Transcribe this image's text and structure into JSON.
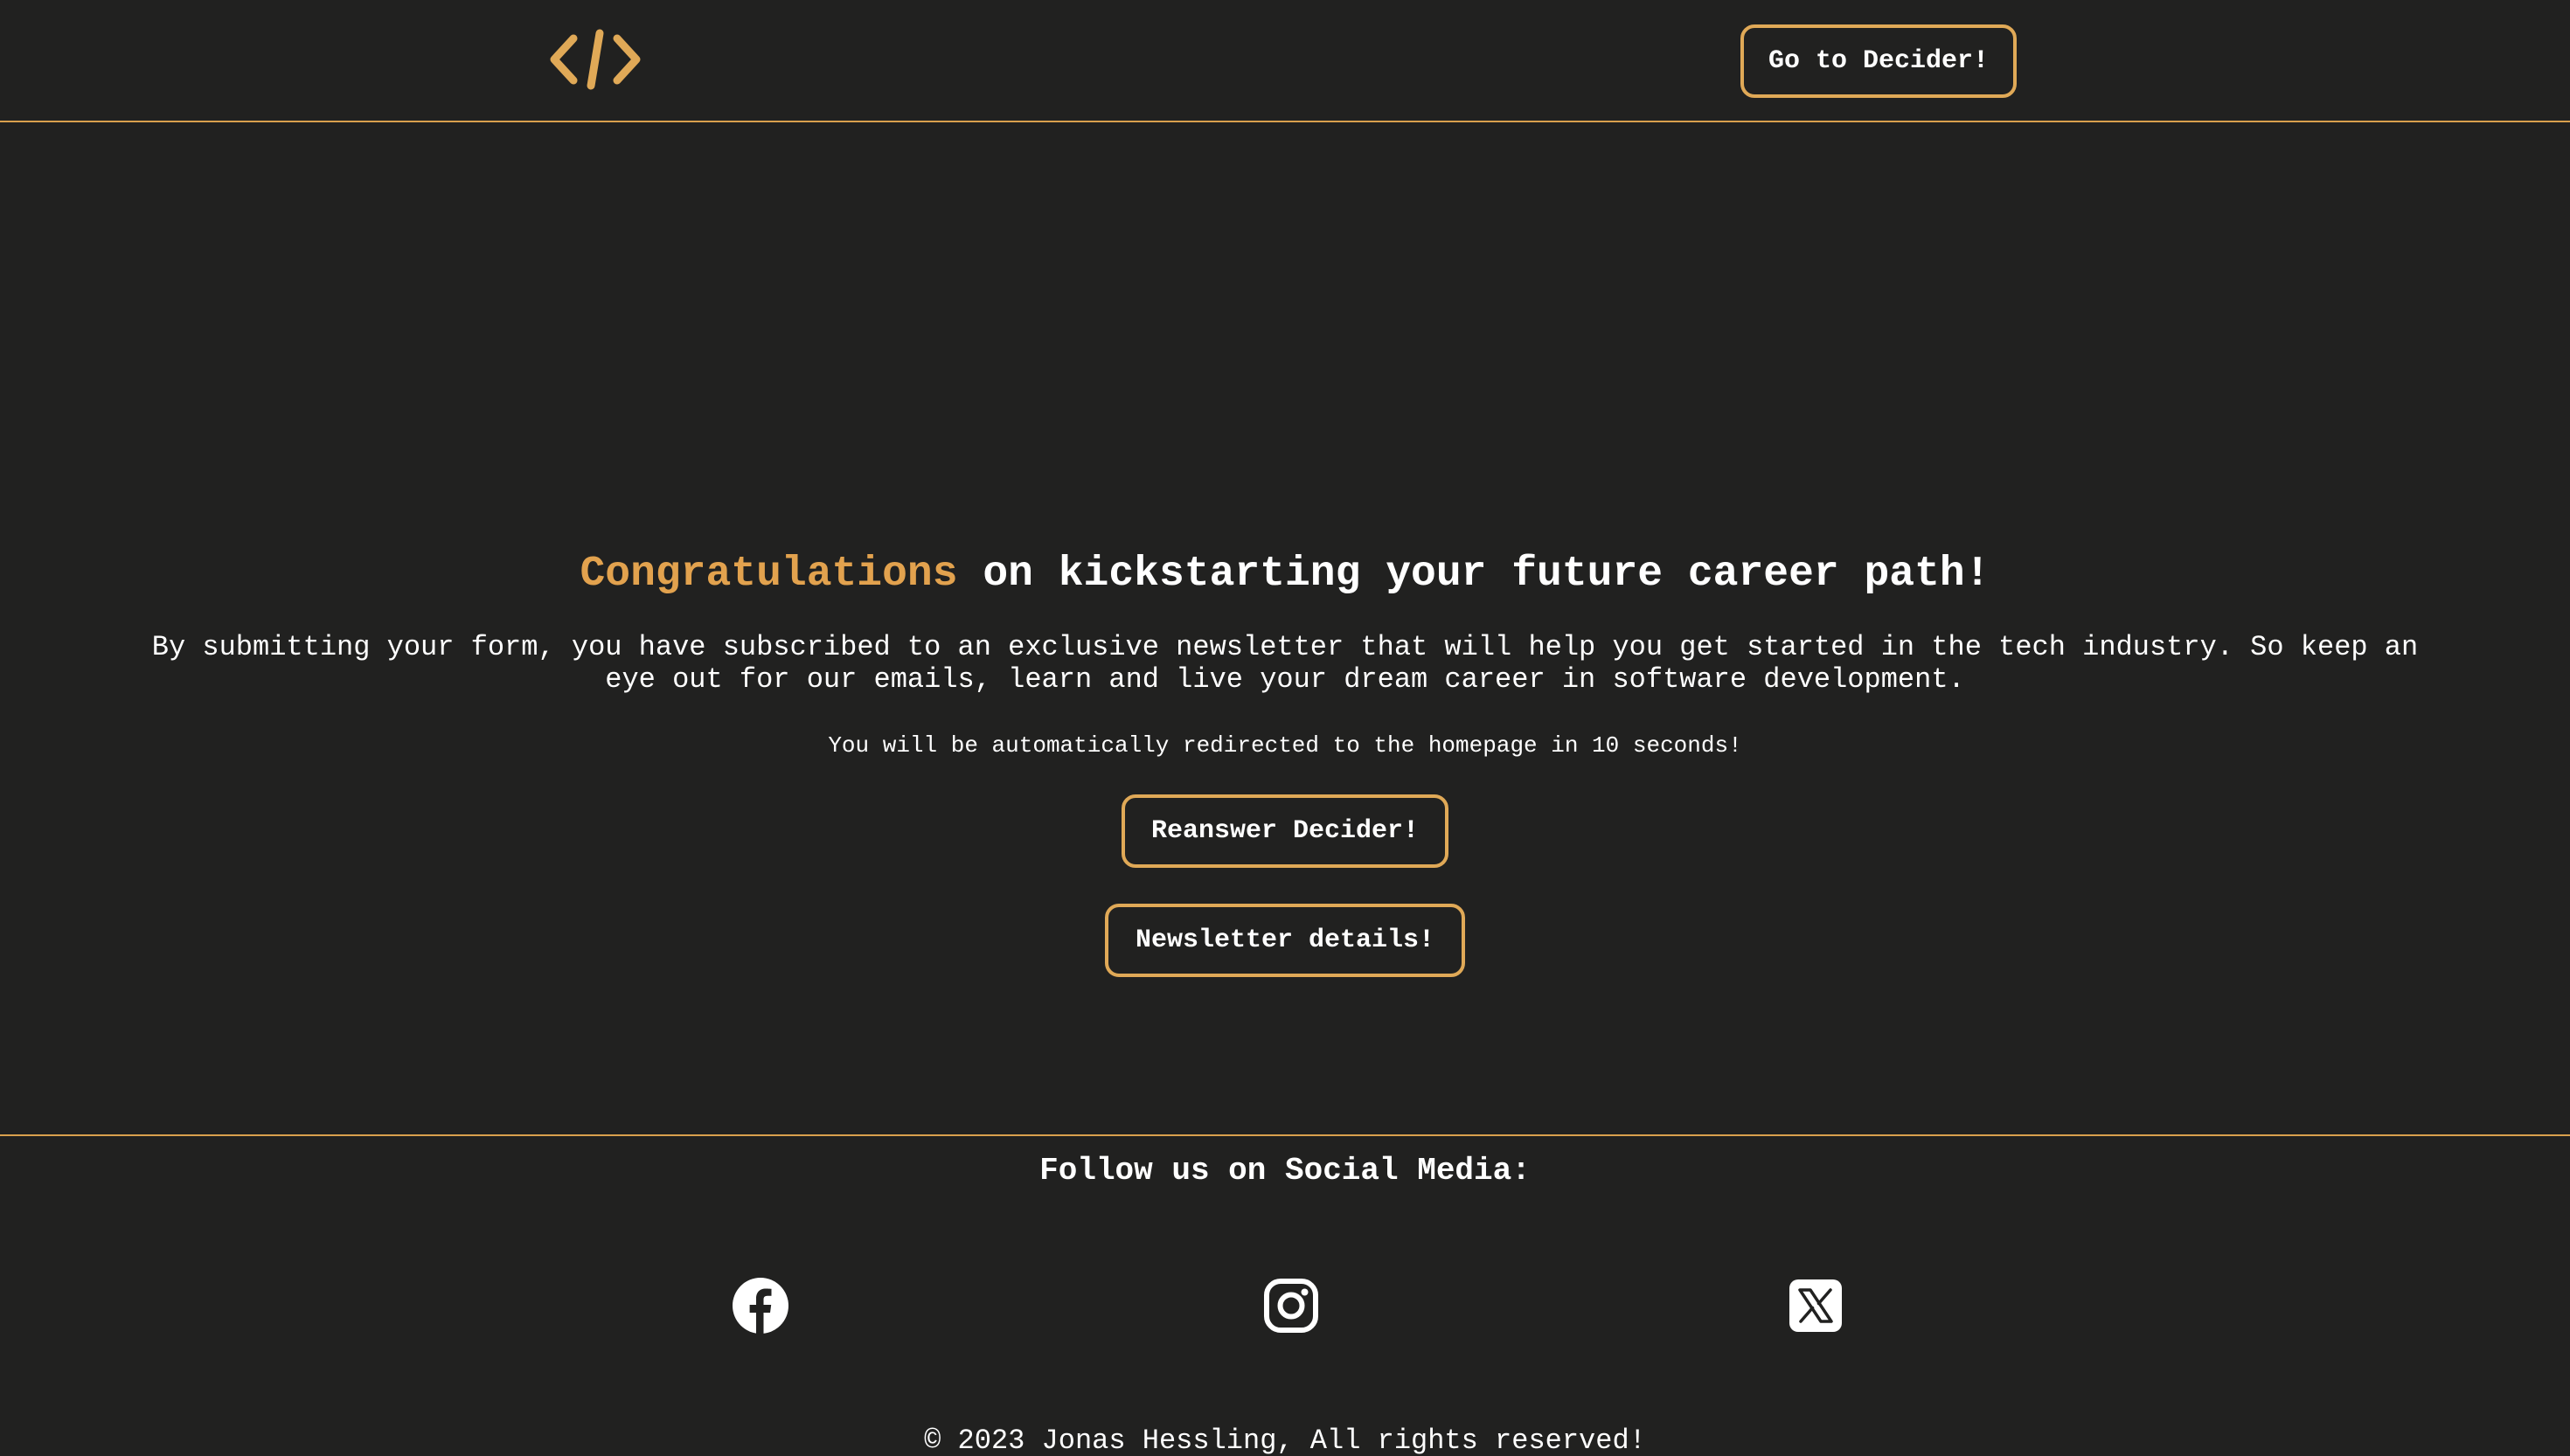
{
  "header": {
    "logo_icon": "code-brackets-icon",
    "cta_label": "Go to Decider!"
  },
  "main": {
    "headline_accent": "Congratulations",
    "headline_rest": " on kickstarting your future career path!",
    "intro": "By submitting your form, you have subscribed to an exclusive newsletter that will help you get started in the tech industry. So keep an eye out for our emails, learn and live your dream career in software development.",
    "redirect_notice": "You will be automatically redirected to the homepage in 10 seconds!",
    "reanswer_label": "Reanswer Decider!",
    "newsletter_label": "Newsletter details!"
  },
  "footer": {
    "title": "Follow us on Social Media:",
    "socials": [
      "facebook-icon",
      "instagram-icon",
      "x-twitter-icon"
    ],
    "copyright": "© 2023 Jonas Hessling, All rights reserved!"
  },
  "colors": {
    "background": "#212120",
    "accent": "#e2a24e",
    "text": "#ffffff"
  }
}
